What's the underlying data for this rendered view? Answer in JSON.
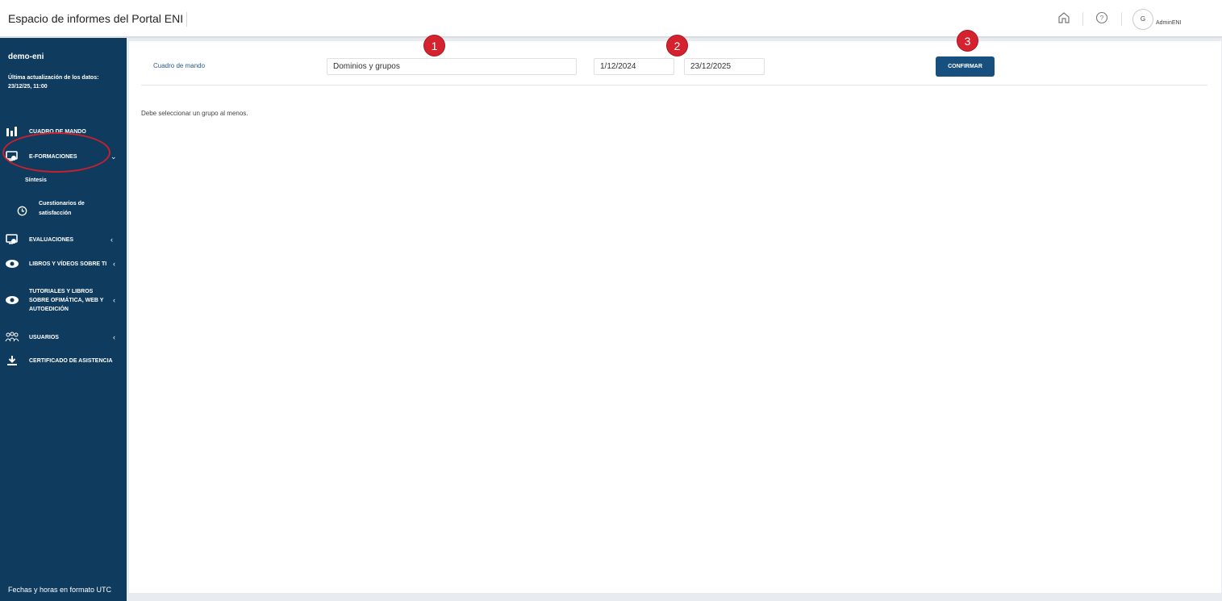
{
  "header": {
    "title": "Espacio de informes del Portal ENI",
    "avatar_initial": "G",
    "username": "AdminENI"
  },
  "sidebar": {
    "org": "demo-eni",
    "updated_label": "Última actualización de los datos:",
    "updated_value": "23/12/25, 11:00",
    "items": [
      {
        "label": "CUADRO DE MANDO",
        "icon": "bar-chart-icon"
      },
      {
        "label": "E-FORMACIONES",
        "icon": "monitor-icon"
      },
      {
        "label": "EVALUACIONES",
        "icon": "monitor-icon"
      },
      {
        "label": "LIBROS Y VÍDEOS SOBRE TI",
        "icon": "eye-icon"
      },
      {
        "label_lines": [
          "TUTORIALES Y LIBROS",
          "SOBRE OFIMÁTICA, WEB Y",
          "AUTOEDICIÓN"
        ],
        "icon": "eye-icon"
      },
      {
        "label": "USUARIOS",
        "icon": "users-icon"
      },
      {
        "label": "CERTIFICADO DE ASISTENCIA",
        "icon": "download-icon"
      }
    ],
    "subitems": {
      "sintesis": "Síntesis",
      "cuestionarios_line1": "Cuestionarios de",
      "cuestionarios_line2": "satisfacción"
    },
    "footer": "Fechas y horas en formato UTC"
  },
  "filters": {
    "breadcrumb": "Cuadro de mando",
    "group_value": "Dominios y grupos",
    "date_from": "1/12/2024",
    "date_to": "23/12/2025",
    "confirm_label": "CONFIRMAR"
  },
  "message": "Debe seleccionar un grupo al menos.",
  "badges": [
    "1",
    "2",
    "3"
  ],
  "colors": {
    "sidebar_bg": "#0e3b5e",
    "button_bg": "#174f7e",
    "badge_red": "#d4232f"
  }
}
